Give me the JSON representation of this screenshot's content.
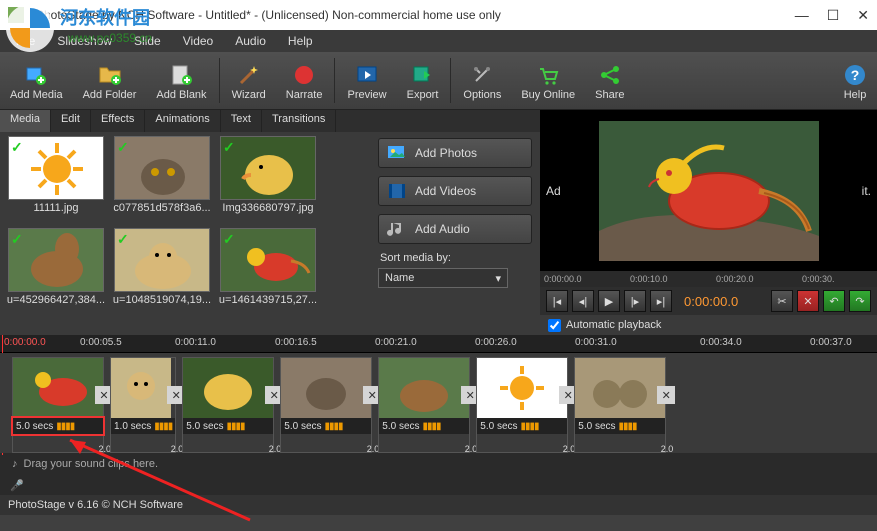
{
  "titlebar": {
    "title": "PhotoStage by NCH Software - Untitled* - (Unlicensed) Non-commercial home use only"
  },
  "menubar": {
    "items": [
      "File",
      "Slideshow",
      "Slide",
      "Video",
      "Audio",
      "Help"
    ]
  },
  "toolbar": {
    "add_media": "Add Media",
    "add_folder": "Add Folder",
    "add_blank": "Add Blank",
    "wizard": "Wizard",
    "narrate": "Narrate",
    "preview": "Preview",
    "export": "Export",
    "options": "Options",
    "buy_online": "Buy Online",
    "share": "Share",
    "help": "Help"
  },
  "tabs": {
    "media": "Media",
    "edit": "Edit",
    "effects": "Effects",
    "animations": "Animations",
    "text": "Text",
    "transitions": "Transitions"
  },
  "media": {
    "items": [
      {
        "name": "11111.jpg"
      },
      {
        "name": "c077851d578f3a6..."
      },
      {
        "name": "Img336680797.jpg"
      },
      {
        "name": "u=452966427,384..."
      },
      {
        "name": "u=1048519074,19..."
      },
      {
        "name": "u=1461439715,27..."
      }
    ]
  },
  "addcol": {
    "add_photos": "Add Photos",
    "add_videos": "Add Videos",
    "add_audio": "Add Audio",
    "sort_label": "Sort media by:",
    "sort_value": "Name"
  },
  "preview": {
    "overlay_left": "Ad",
    "overlay_right": "it.",
    "ruler": [
      "0:00:00.0",
      "0:00:10.0",
      "0:00:20.0",
      "0:00:30."
    ],
    "time": "0:00:00.0",
    "auto": "Automatic playback"
  },
  "timeline": {
    "ruler": [
      "0:00:00.0",
      "0:00:05.5",
      "0:00:11.0",
      "0:00:16.5",
      "0:00:21.0",
      "0:00:26.0",
      "0:00:31.0",
      "0:00:34.0",
      "0:00:37.0"
    ],
    "clips": [
      {
        "duration": "5.0 secs",
        "trans": "2.0",
        "hl": true
      },
      {
        "duration": "1.0 secs",
        "trans": "2.0",
        "hl": false
      },
      {
        "duration": "5.0 secs",
        "trans": "2.0",
        "hl": false
      },
      {
        "duration": "5.0 secs",
        "trans": "2.0",
        "hl": false
      },
      {
        "duration": "5.0 secs",
        "trans": "2.0",
        "hl": false
      },
      {
        "duration": "5.0 secs",
        "trans": "2.0",
        "hl": false
      },
      {
        "duration": "5.0 secs",
        "trans": "2.0",
        "hl": false
      }
    ],
    "audio_hint": "Drag your sound clips here."
  },
  "status": {
    "text": "PhotoStage v 6.16  © NCH Software"
  },
  "watermark": {
    "site": "河东软件园",
    "url": "www.pc0359.cn"
  },
  "colors": {
    "thumb_sun": "#f7d13b",
    "thumb_cat": "#8a7a68",
    "thumb_duck": "#d9a83a",
    "thumb_squirrel": "#7a5a38",
    "thumb_cheetah": "#b89860",
    "thumb_bird": "#4a6a3a",
    "bird_body": "#d83a2a",
    "bird_head": "#f0c020"
  }
}
